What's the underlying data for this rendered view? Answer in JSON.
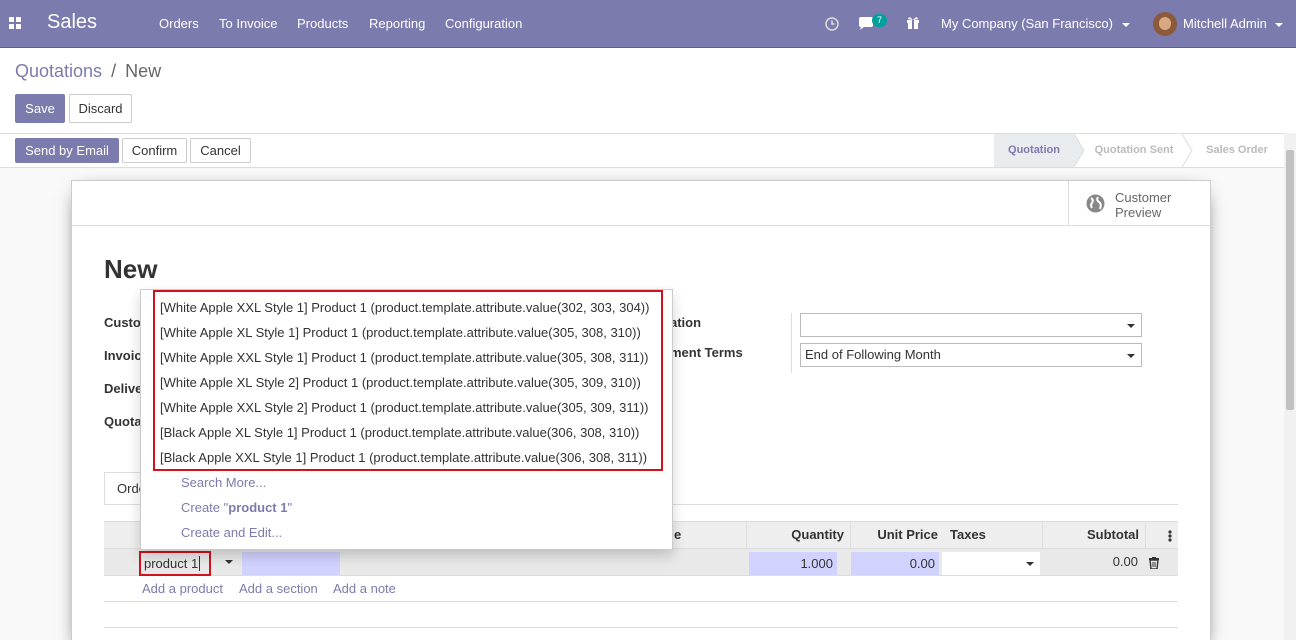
{
  "navbar": {
    "brand": "Sales",
    "menu": [
      "Orders",
      "To Invoice",
      "Products",
      "Reporting",
      "Configuration"
    ],
    "messages_count": "7",
    "company": "My Company (San Francisco)",
    "user": "Mitchell Admin"
  },
  "breadcrumb": {
    "parent": "Quotations",
    "separator": "/",
    "current": "New"
  },
  "buttons": {
    "save": "Save",
    "discard": "Discard",
    "send_email": "Send by Email",
    "confirm": "Confirm",
    "cancel": "Cancel"
  },
  "stages": [
    "Quotation",
    "Quotation Sent",
    "Sales Order"
  ],
  "customer_preview": {
    "line1": "Customer",
    "line2": "Preview"
  },
  "form": {
    "title": "New",
    "labels_left": [
      "Custo",
      "Invoic",
      "Delive",
      "Quota"
    ],
    "labels_right": [
      "ation",
      "ment Terms"
    ],
    "payment_terms": "End of Following Month"
  },
  "tab": {
    "label": "Orde"
  },
  "table": {
    "headers": {
      "description": "e",
      "quantity": "Quantity",
      "unit_price": "Unit Price",
      "taxes": "Taxes",
      "subtotal": "Subtotal"
    },
    "row": {
      "product": "product 1",
      "quantity": "1.000",
      "unit_price": "0.00",
      "subtotal": "0.00"
    },
    "add_product": "Add a product",
    "add_section": "Add a section",
    "add_note": "Add a note"
  },
  "dropdown": {
    "items": [
      "[White Apple XXL Style 1] Product 1 (product.template.attribute.value(302, 303, 304))",
      "[White Apple XL Style 1] Product 1 (product.template.attribute.value(305, 308, 310))",
      "[White Apple XXL Style 1] Product 1 (product.template.attribute.value(305, 308, 311))",
      "[White Apple XL Style 2] Product 1 (product.template.attribute.value(305, 309, 310))",
      "[White Apple XXL Style 2] Product 1 (product.template.attribute.value(305, 309, 311))",
      "[Black Apple XL Style 1] Product 1 (product.template.attribute.value(306, 308, 310))",
      "[Black Apple XXL Style 1] Product 1 (product.template.attribute.value(306, 308, 311))"
    ],
    "search_more": "Search More...",
    "create_prefix": "Create \"",
    "create_term": "product 1",
    "create_suffix": "\"",
    "create_edit": "Create and Edit..."
  },
  "colors": {
    "brand": "#7c7bad",
    "highlight": "#d0121b",
    "input_bg": "#d2d2ff"
  }
}
